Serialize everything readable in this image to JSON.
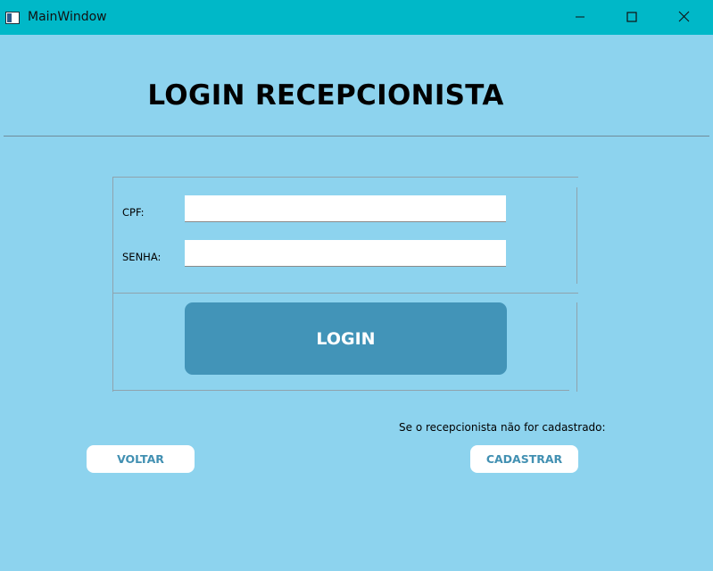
{
  "window": {
    "title": "MainWindow",
    "controls": {
      "minimize": "minimize-icon",
      "maximize": "maximize-icon",
      "close": "close-icon"
    }
  },
  "main": {
    "heading": "LOGIN RECEPCIONISTA",
    "form": {
      "cpf_label": "CPF:",
      "cpf_value": "",
      "senha_label": "SENHA:",
      "senha_value": "",
      "login_label": "LOGIN"
    },
    "footer": {
      "note": "Se o recepcionista não for cadastrado:",
      "back_label": "VOLTAR",
      "register_label": "CADASTRAR"
    }
  },
  "colors": {
    "titlebar": "#00b8c8",
    "background": "#8dd3ee",
    "login_button": "#4294b8",
    "secondary_button_text": "#4290b2"
  }
}
